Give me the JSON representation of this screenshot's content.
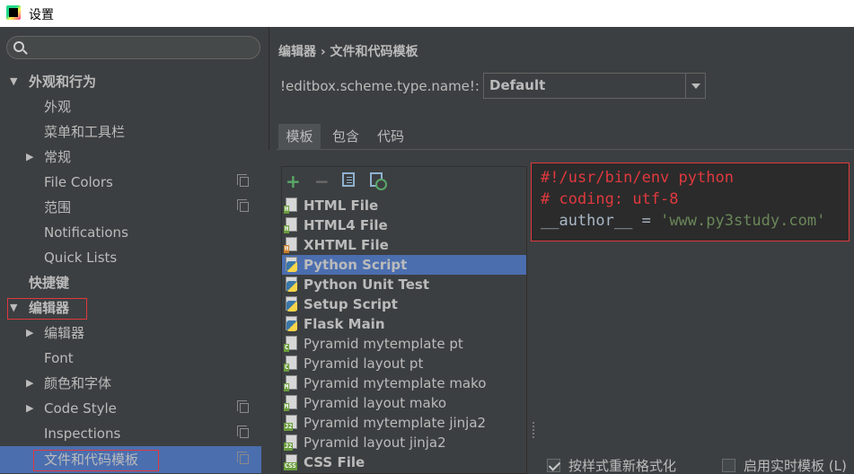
{
  "window": {
    "title": "设置",
    "app_icon": "pycharm-icon"
  },
  "search": {
    "placeholder": "",
    "value": ""
  },
  "sidebar": {
    "items": [
      {
        "label": "外观和行为",
        "bold": true,
        "expanded": true
      },
      {
        "label": "外观"
      },
      {
        "label": "菜单和工具栏"
      },
      {
        "label": "常规",
        "expandable": true
      },
      {
        "label": "File Colors",
        "project_icon": true
      },
      {
        "label": "范围",
        "project_icon": true
      },
      {
        "label": "Notifications"
      },
      {
        "label": "Quick Lists"
      },
      {
        "label": "快捷键",
        "bold": true
      },
      {
        "label": "编辑器",
        "bold": true,
        "expanded": true,
        "highlighted": true
      },
      {
        "label": "编辑器",
        "expandable": true
      },
      {
        "label": "Font"
      },
      {
        "label": "颜色和字体",
        "expandable": true
      },
      {
        "label": "Code Style",
        "expandable": true,
        "project_icon": true
      },
      {
        "label": "Inspections",
        "project_icon": true
      },
      {
        "label": "文件和代码模板",
        "selected": true,
        "highlighted": true,
        "project_icon": true
      }
    ]
  },
  "main": {
    "breadcrumb": "编辑器 › 文件和代码模板",
    "scheme": {
      "label": "!editbox.scheme.type.name!:",
      "value": "Default"
    },
    "tabs": [
      {
        "label": "模板",
        "active": true
      },
      {
        "label": "包含"
      },
      {
        "label": "代码"
      }
    ],
    "toolbar": {
      "add": "+",
      "remove": "−",
      "icons": [
        "add-icon",
        "remove-icon",
        "copy-icon",
        "reset-icon"
      ]
    },
    "templates": [
      {
        "label": "HTML File",
        "bold": true,
        "icon": "html-file-icon",
        "tag": "H",
        "tag_color": "#6a9b3c"
      },
      {
        "label": "HTML4 File",
        "bold": true,
        "icon": "html-file-icon",
        "tag": "H",
        "tag_color": "#6a9b3c"
      },
      {
        "label": "XHTML File",
        "bold": true,
        "icon": "xhtml-file-icon",
        "tag": "H",
        "tag_color": "#c97c2b"
      },
      {
        "label": "Python Script",
        "bold": true,
        "icon": "python-file-icon",
        "selected": true
      },
      {
        "label": "Python Unit Test",
        "bold": true,
        "icon": "python-file-icon"
      },
      {
        "label": "Setup Script",
        "bold": true,
        "icon": "python-file-icon"
      },
      {
        "label": "Flask Main",
        "bold": true,
        "icon": "python-file-icon"
      },
      {
        "label": "Pyramid mytemplate pt",
        "icon": "chameleon-file-icon",
        "tag": "C",
        "tag_color": "#6a9b3c"
      },
      {
        "label": "Pyramid layout pt",
        "icon": "chameleon-file-icon",
        "tag": "C",
        "tag_color": "#6a9b3c"
      },
      {
        "label": "Pyramid mytemplate mako",
        "icon": "mako-file-icon",
        "tag": "M",
        "tag_color": "#6a9b3c"
      },
      {
        "label": "Pyramid layout mako",
        "icon": "mako-file-icon",
        "tag": "M",
        "tag_color": "#6a9b3c"
      },
      {
        "label": "Pyramid mytemplate jinja2",
        "icon": "jinja2-file-icon",
        "tag": "J2",
        "tag_color": "#6a9b3c"
      },
      {
        "label": "Pyramid layout jinja2",
        "icon": "jinja2-file-icon",
        "tag": "J2",
        "tag_color": "#6a9b3c"
      },
      {
        "label": "CSS File",
        "bold": true,
        "icon": "css-file-icon",
        "tag": "CSS",
        "tag_color": "#6a9b3c"
      }
    ],
    "editor": {
      "lines": [
        {
          "parts": [
            {
              "text": "#!/usr/bin/env python",
              "cls": "c-red"
            }
          ]
        },
        {
          "parts": [
            {
              "text": "# coding: utf-8",
              "cls": "c-red"
            }
          ]
        },
        {
          "parts": [
            {
              "text": "__author__",
              "cls": "c-normal"
            },
            {
              "text": " = ",
              "cls": "c-normal"
            },
            {
              "text": "'www.py3study.com'",
              "cls": "c-green"
            }
          ]
        }
      ]
    },
    "checkboxes": [
      {
        "label": "按样式重新格式化",
        "checked": true
      },
      {
        "label": "启用实时模板 (L)",
        "checked": false
      }
    ]
  },
  "colors": {
    "background": "#3c3f41",
    "selection": "#4b6eaf",
    "highlight_border": "#e0393e",
    "editor_background": "#2b2b2b",
    "code_red": "#e0393e",
    "code_string": "#6a8759"
  }
}
